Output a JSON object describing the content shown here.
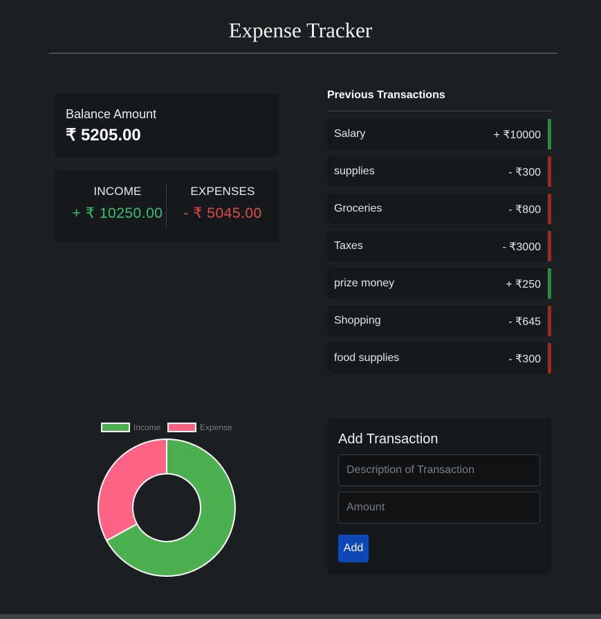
{
  "header": {
    "title": "Expense Tracker"
  },
  "balance": {
    "label": "Balance Amount",
    "value": "₹ 5205.00"
  },
  "summary": {
    "income_label": "INCOME",
    "income_value": "+ ₹ 10250.00",
    "expense_label": "EXPENSES",
    "expense_value": "- ₹ 5045.00"
  },
  "transactions": {
    "heading": "Previous Transactions",
    "items": [
      {
        "description": "Salary",
        "amount": "+ ₹10000",
        "type": "income"
      },
      {
        "description": "supplies",
        "amount": "- ₹300",
        "type": "expense"
      },
      {
        "description": "Groceries",
        "amount": "- ₹800",
        "type": "expense"
      },
      {
        "description": "Taxes",
        "amount": "- ₹3000",
        "type": "expense"
      },
      {
        "description": "prize money",
        "amount": "+ ₹250",
        "type": "income"
      },
      {
        "description": "Shopping",
        "amount": "- ₹645",
        "type": "expense"
      },
      {
        "description": "food supplies",
        "amount": "- ₹300",
        "type": "expense"
      }
    ]
  },
  "chart_data": {
    "type": "pie",
    "categories": [
      "Income",
      "Expense"
    ],
    "values": [
      10250,
      5045
    ],
    "colors": [
      "#4caf50",
      "#ff6384"
    ],
    "legend": "top"
  },
  "add_form": {
    "title": "Add Transaction",
    "description_placeholder": "Description of Transaction",
    "description_value": "",
    "amount_placeholder": "Amount",
    "amount_value": "",
    "button_label": "Add"
  },
  "colors": {
    "background": "#1b1f21",
    "card": "#16191b",
    "income": "#35c16f",
    "expense": "#e24b46",
    "income_bar": "#2b8a3e",
    "expense_bar": "#9b2a25",
    "button": "#0d47b8"
  }
}
